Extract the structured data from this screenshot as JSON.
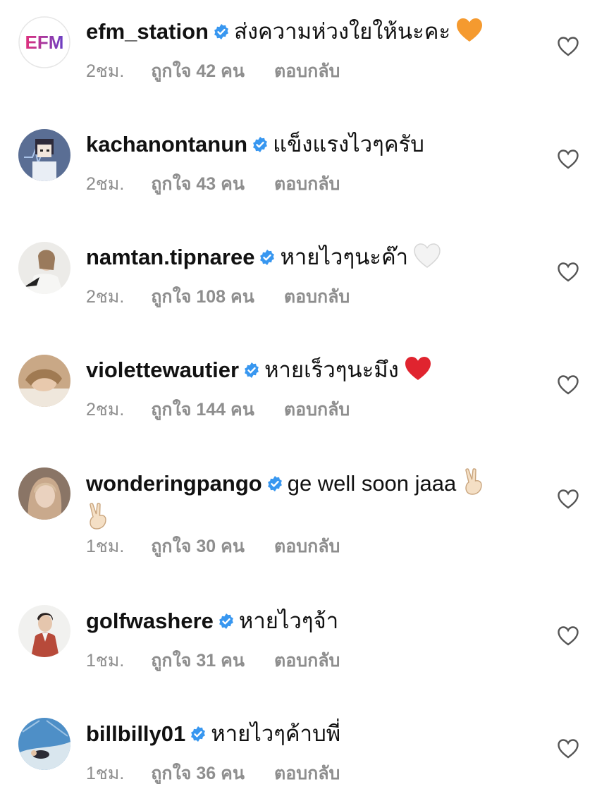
{
  "comments": [
    {
      "username": "efm_station",
      "text": "ส่งความห่วงใยให้นะคะ",
      "emoji": "orange-heart",
      "time": "2ชม.",
      "likes": "ถูกใจ 42 คน",
      "reply": "ตอบกลับ"
    },
    {
      "username": "kachanontanun",
      "text": "แข็งแรงไวๆครับ",
      "emoji": "",
      "time": "2ชม.",
      "likes": "ถูกใจ 43 คน",
      "reply": "ตอบกลับ"
    },
    {
      "username": "namtan.tipnaree",
      "text": "หายไวๆนะค๊า",
      "emoji": "white-heart",
      "time": "2ชม.",
      "likes": "ถูกใจ 108 คน",
      "reply": "ตอบกลับ"
    },
    {
      "username": "violettewautier",
      "text": "หายเร็วๆนะมึง",
      "emoji": "red-heart",
      "time": "2ชม.",
      "likes": "ถูกใจ 144 คน",
      "reply": "ตอบกลับ"
    },
    {
      "username": "wonderingpango",
      "text": "ge well soon jaaa",
      "emoji": "victory-hand x2",
      "time": "1ชม.",
      "likes": "ถูกใจ 30 คน",
      "reply": "ตอบกลับ"
    },
    {
      "username": "golfwashere",
      "text": "หายไวๆจ้า",
      "emoji": "",
      "time": "1ชม.",
      "likes": "ถูกใจ 31 คน",
      "reply": "ตอบกลับ"
    },
    {
      "username": "billbilly01",
      "text": "หายไวๆค้าบพี่",
      "emoji": "",
      "time": "1ชม.",
      "likes": "ถูกใจ 36 คน",
      "reply": "ตอบกลับ"
    }
  ],
  "avatars": {
    "efm_station": "EFM"
  },
  "colors": {
    "verified_blue": "#3897f0",
    "meta_gray": "#8e8e8e",
    "efm_gradient_start": "#e0307c",
    "efm_gradient_end": "#6a3fc4"
  },
  "icons": {
    "verified": "verified-badge-icon",
    "like": "heart-outline-icon"
  }
}
